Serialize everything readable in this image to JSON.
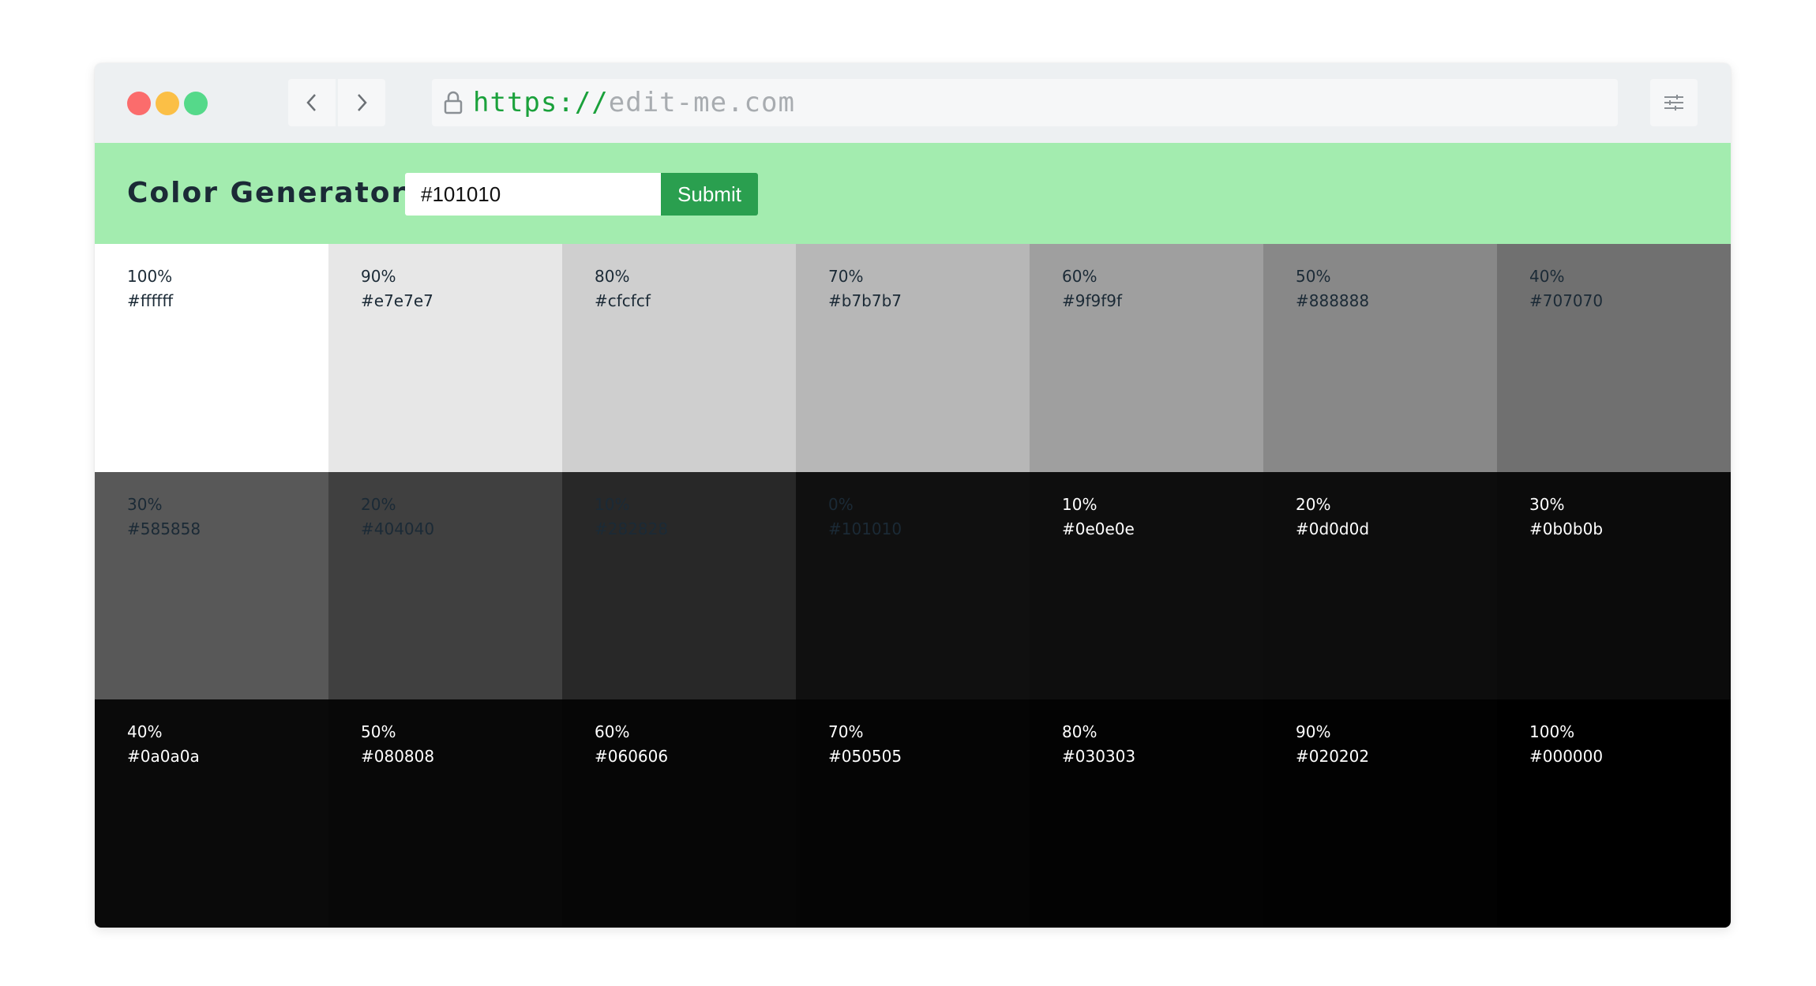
{
  "browser": {
    "url_scheme": "https://",
    "url_host": "edit-me.com"
  },
  "app": {
    "title": "Color Generator",
    "input_value": "#101010",
    "submit_label": "Submit"
  },
  "colors": {
    "dark_text": "#1b2a36",
    "light_text": "#ffffff",
    "header_bg": "#a3ecaf",
    "button_bg": "#2a9f4f"
  },
  "swatches": [
    {
      "percent": "100%",
      "hex": "#ffffff",
      "text": "dark"
    },
    {
      "percent": "90%",
      "hex": "#e7e7e7",
      "text": "dark"
    },
    {
      "percent": "80%",
      "hex": "#cfcfcf",
      "text": "dark"
    },
    {
      "percent": "70%",
      "hex": "#b7b7b7",
      "text": "dark"
    },
    {
      "percent": "60%",
      "hex": "#9f9f9f",
      "text": "dark"
    },
    {
      "percent": "50%",
      "hex": "#888888",
      "text": "dark"
    },
    {
      "percent": "40%",
      "hex": "#707070",
      "text": "dark"
    },
    {
      "percent": "30%",
      "hex": "#585858",
      "text": "dark"
    },
    {
      "percent": "20%",
      "hex": "#404040",
      "text": "dark"
    },
    {
      "percent": "10%",
      "hex": "#282828",
      "text": "dark"
    },
    {
      "percent": "0%",
      "hex": "#101010",
      "text": "dark"
    },
    {
      "percent": "10%",
      "hex": "#0e0e0e",
      "text": "light"
    },
    {
      "percent": "20%",
      "hex": "#0d0d0d",
      "text": "light"
    },
    {
      "percent": "30%",
      "hex": "#0b0b0b",
      "text": "light"
    },
    {
      "percent": "40%",
      "hex": "#0a0a0a",
      "text": "light"
    },
    {
      "percent": "50%",
      "hex": "#080808",
      "text": "light"
    },
    {
      "percent": "60%",
      "hex": "#060606",
      "text": "light"
    },
    {
      "percent": "70%",
      "hex": "#050505",
      "text": "light"
    },
    {
      "percent": "80%",
      "hex": "#030303",
      "text": "light"
    },
    {
      "percent": "90%",
      "hex": "#020202",
      "text": "light"
    },
    {
      "percent": "100%",
      "hex": "#000000",
      "text": "light"
    }
  ]
}
